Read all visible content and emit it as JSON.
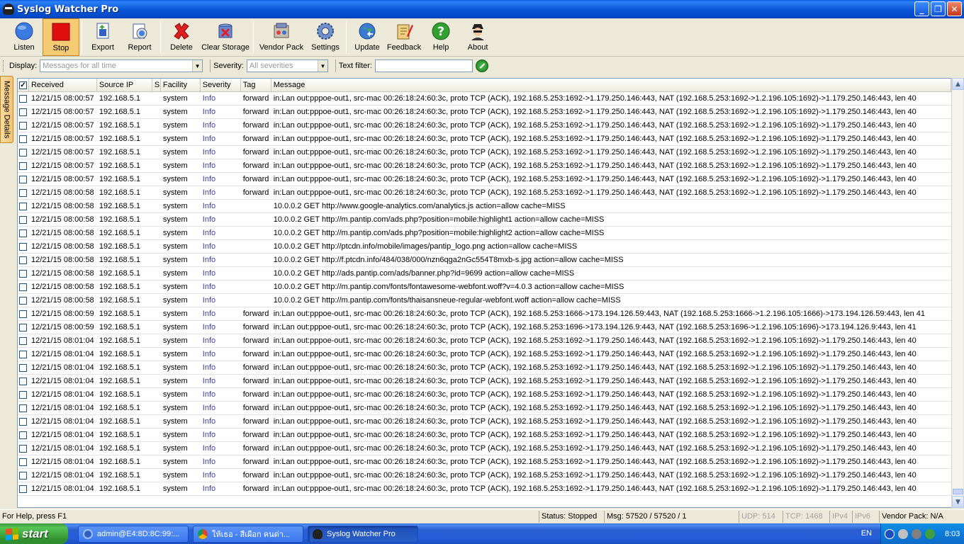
{
  "window": {
    "title": "Syslog Watcher Pro"
  },
  "toolbar": {
    "buttons": [
      {
        "label": "Listen"
      },
      {
        "label": "Stop"
      },
      {
        "label": "Export"
      },
      {
        "label": "Report"
      },
      {
        "label": "Delete"
      },
      {
        "label": "Clear Storage"
      },
      {
        "label": "Vendor Pack"
      },
      {
        "label": "Settings"
      },
      {
        "label": "Update"
      },
      {
        "label": "Feedback"
      },
      {
        "label": "Help"
      },
      {
        "label": "About"
      }
    ]
  },
  "filter": {
    "display_label": "Display:",
    "display_value": "Messages for all time",
    "severity_label": "Severity:",
    "severity_value": "All severities",
    "text_filter_label": "Text filter:",
    "text_filter_value": ""
  },
  "side_tab": {
    "label": "Message Details"
  },
  "grid": {
    "columns": [
      "Received",
      "Source IP",
      "S",
      "Facility",
      "Severity",
      "Tag",
      "Message"
    ],
    "rows": [
      {
        "received": "12/21/15 08:00:57",
        "ip": "192.168.5.1",
        "facility": "system",
        "severity": "Info",
        "tag": "forward",
        "message": "in:Lan out:pppoe-out1, src-mac 00:26:18:24:60:3c, proto TCP (ACK), 192.168.5.253:1692->1.179.250.146:443, NAT (192.168.5.253:1692->1.2.196.105:1692)->1.179.250.146:443, len 40"
      },
      {
        "received": "12/21/15 08:00:57",
        "ip": "192.168.5.1",
        "facility": "system",
        "severity": "Info",
        "tag": "forward",
        "message": "in:Lan out:pppoe-out1, src-mac 00:26:18:24:60:3c, proto TCP (ACK), 192.168.5.253:1692->1.179.250.146:443, NAT (192.168.5.253:1692->1.2.196.105:1692)->1.179.250.146:443, len 40"
      },
      {
        "received": "12/21/15 08:00:57",
        "ip": "192.168.5.1",
        "facility": "system",
        "severity": "Info",
        "tag": "forward",
        "message": "in:Lan out:pppoe-out1, src-mac 00:26:18:24:60:3c, proto TCP (ACK), 192.168.5.253:1692->1.179.250.146:443, NAT (192.168.5.253:1692->1.2.196.105:1692)->1.179.250.146:443, len 40"
      },
      {
        "received": "12/21/15 08:00:57",
        "ip": "192.168.5.1",
        "facility": "system",
        "severity": "Info",
        "tag": "forward",
        "message": "in:Lan out:pppoe-out1, src-mac 00:26:18:24:60:3c, proto TCP (ACK), 192.168.5.253:1692->1.179.250.146:443, NAT (192.168.5.253:1692->1.2.196.105:1692)->1.179.250.146:443, len 40"
      },
      {
        "received": "12/21/15 08:00:57",
        "ip": "192.168.5.1",
        "facility": "system",
        "severity": "Info",
        "tag": "forward",
        "message": "in:Lan out:pppoe-out1, src-mac 00:26:18:24:60:3c, proto TCP (ACK), 192.168.5.253:1692->1.179.250.146:443, NAT (192.168.5.253:1692->1.2.196.105:1692)->1.179.250.146:443, len 40"
      },
      {
        "received": "12/21/15 08:00:57",
        "ip": "192.168.5.1",
        "facility": "system",
        "severity": "Info",
        "tag": "forward",
        "message": "in:Lan out:pppoe-out1, src-mac 00:26:18:24:60:3c, proto TCP (ACK), 192.168.5.253:1692->1.179.250.146:443, NAT (192.168.5.253:1692->1.2.196.105:1692)->1.179.250.146:443, len 40"
      },
      {
        "received": "12/21/15 08:00:57",
        "ip": "192.168.5.1",
        "facility": "system",
        "severity": "Info",
        "tag": "forward",
        "message": "in:Lan out:pppoe-out1, src-mac 00:26:18:24:60:3c, proto TCP (ACK), 192.168.5.253:1692->1.179.250.146:443, NAT (192.168.5.253:1692->1.2.196.105:1692)->1.179.250.146:443, len 40"
      },
      {
        "received": "12/21/15 08:00:58",
        "ip": "192.168.5.1",
        "facility": "system",
        "severity": "Info",
        "tag": "forward",
        "message": "in:Lan out:pppoe-out1, src-mac 00:26:18:24:60:3c, proto TCP (ACK), 192.168.5.253:1692->1.179.250.146:443, NAT (192.168.5.253:1692->1.2.196.105:1692)->1.179.250.146:443, len 40"
      },
      {
        "received": "12/21/15 08:00:58",
        "ip": "192.168.5.1",
        "facility": "system",
        "severity": "Info",
        "tag": "",
        "message": "10.0.0.2 GET http://www.google-analytics.com/analytics.js  action=allow cache=MISS"
      },
      {
        "received": "12/21/15 08:00:58",
        "ip": "192.168.5.1",
        "facility": "system",
        "severity": "Info",
        "tag": "",
        "message": "10.0.0.2 GET http://m.pantip.com/ads.php?position=mobile:highlight1  action=allow cache=MISS"
      },
      {
        "received": "12/21/15 08:00:58",
        "ip": "192.168.5.1",
        "facility": "system",
        "severity": "Info",
        "tag": "",
        "message": "10.0.0.2 GET http://m.pantip.com/ads.php?position=mobile:highlight2  action=allow cache=MISS"
      },
      {
        "received": "12/21/15 08:00:58",
        "ip": "192.168.5.1",
        "facility": "system",
        "severity": "Info",
        "tag": "",
        "message": "10.0.0.2 GET http://ptcdn.info/mobile/images/pantip_logo.png  action=allow cache=MISS"
      },
      {
        "received": "12/21/15 08:00:58",
        "ip": "192.168.5.1",
        "facility": "system",
        "severity": "Info",
        "tag": "",
        "message": "10.0.0.2 GET http://f.ptcdn.info/484/038/000/nzn6qga2nGc554T8mxb-s.jpg  action=allow cache=MISS"
      },
      {
        "received": "12/21/15 08:00:58",
        "ip": "192.168.5.1",
        "facility": "system",
        "severity": "Info",
        "tag": "",
        "message": "10.0.0.2 GET http://ads.pantip.com/ads/banner.php?id=9699  action=allow cache=MISS"
      },
      {
        "received": "12/21/15 08:00:58",
        "ip": "192.168.5.1",
        "facility": "system",
        "severity": "Info",
        "tag": "",
        "message": "10.0.0.2 GET http://m.pantip.com/fonts/fontawesome-webfont.woff?v=4.0.3  action=allow cache=MISS"
      },
      {
        "received": "12/21/15 08:00:58",
        "ip": "192.168.5.1",
        "facility": "system",
        "severity": "Info",
        "tag": "",
        "message": "10.0.0.2 GET http://m.pantip.com/fonts/thaisansneue-regular-webfont.woff  action=allow cache=MISS"
      },
      {
        "received": "12/21/15 08:00:59",
        "ip": "192.168.5.1",
        "facility": "system",
        "severity": "Info",
        "tag": "forward",
        "message": "in:Lan out:pppoe-out1, src-mac 00:26:18:24:60:3c, proto TCP (ACK), 192.168.5.253:1666->173.194.126.59:443, NAT (192.168.5.253:1666->1.2.196.105:1666)->173.194.126.59:443, len 41"
      },
      {
        "received": "12/21/15 08:00:59",
        "ip": "192.168.5.1",
        "facility": "system",
        "severity": "Info",
        "tag": "forward",
        "message": "in:Lan out:pppoe-out1, src-mac 00:26:18:24:60:3c, proto TCP (ACK), 192.168.5.253:1696->173.194.126.9:443, NAT (192.168.5.253:1696->1.2.196.105:1696)->173.194.126.9:443, len 41"
      },
      {
        "received": "12/21/15 08:01:04",
        "ip": "192.168.5.1",
        "facility": "system",
        "severity": "Info",
        "tag": "forward",
        "message": "in:Lan out:pppoe-out1, src-mac 00:26:18:24:60:3c, proto TCP (ACK), 192.168.5.253:1692->1.179.250.146:443, NAT (192.168.5.253:1692->1.2.196.105:1692)->1.179.250.146:443, len 40"
      },
      {
        "received": "12/21/15 08:01:04",
        "ip": "192.168.5.1",
        "facility": "system",
        "severity": "Info",
        "tag": "forward",
        "message": "in:Lan out:pppoe-out1, src-mac 00:26:18:24:60:3c, proto TCP (ACK), 192.168.5.253:1692->1.179.250.146:443, NAT (192.168.5.253:1692->1.2.196.105:1692)->1.179.250.146:443, len 40"
      },
      {
        "received": "12/21/15 08:01:04",
        "ip": "192.168.5.1",
        "facility": "system",
        "severity": "Info",
        "tag": "forward",
        "message": "in:Lan out:pppoe-out1, src-mac 00:26:18:24:60:3c, proto TCP (ACK), 192.168.5.253:1692->1.179.250.146:443, NAT (192.168.5.253:1692->1.2.196.105:1692)->1.179.250.146:443, len 40"
      },
      {
        "received": "12/21/15 08:01:04",
        "ip": "192.168.5.1",
        "facility": "system",
        "severity": "Info",
        "tag": "forward",
        "message": "in:Lan out:pppoe-out1, src-mac 00:26:18:24:60:3c, proto TCP (ACK), 192.168.5.253:1692->1.179.250.146:443, NAT (192.168.5.253:1692->1.2.196.105:1692)->1.179.250.146:443, len 40"
      },
      {
        "received": "12/21/15 08:01:04",
        "ip": "192.168.5.1",
        "facility": "system",
        "severity": "Info",
        "tag": "forward",
        "message": "in:Lan out:pppoe-out1, src-mac 00:26:18:24:60:3c, proto TCP (ACK), 192.168.5.253:1692->1.179.250.146:443, NAT (192.168.5.253:1692->1.2.196.105:1692)->1.179.250.146:443, len 40"
      },
      {
        "received": "12/21/15 08:01:04",
        "ip": "192.168.5.1",
        "facility": "system",
        "severity": "Info",
        "tag": "forward",
        "message": "in:Lan out:pppoe-out1, src-mac 00:26:18:24:60:3c, proto TCP (ACK), 192.168.5.253:1692->1.179.250.146:443, NAT (192.168.5.253:1692->1.2.196.105:1692)->1.179.250.146:443, len 40"
      },
      {
        "received": "12/21/15 08:01:04",
        "ip": "192.168.5.1",
        "facility": "system",
        "severity": "Info",
        "tag": "forward",
        "message": "in:Lan out:pppoe-out1, src-mac 00:26:18:24:60:3c, proto TCP (ACK), 192.168.5.253:1692->1.179.250.146:443, NAT (192.168.5.253:1692->1.2.196.105:1692)->1.179.250.146:443, len 40"
      },
      {
        "received": "12/21/15 08:01:04",
        "ip": "192.168.5.1",
        "facility": "system",
        "severity": "Info",
        "tag": "forward",
        "message": "in:Lan out:pppoe-out1, src-mac 00:26:18:24:60:3c, proto TCP (ACK), 192.168.5.253:1692->1.179.250.146:443, NAT (192.168.5.253:1692->1.2.196.105:1692)->1.179.250.146:443, len 40"
      },
      {
        "received": "12/21/15 08:01:04",
        "ip": "192.168.5.1",
        "facility": "system",
        "severity": "Info",
        "tag": "forward",
        "message": "in:Lan out:pppoe-out1, src-mac 00:26:18:24:60:3c, proto TCP (ACK), 192.168.5.253:1692->1.179.250.146:443, NAT (192.168.5.253:1692->1.2.196.105:1692)->1.179.250.146:443, len 40"
      },
      {
        "received": "12/21/15 08:01:04",
        "ip": "192.168.5.1",
        "facility": "system",
        "severity": "Info",
        "tag": "forward",
        "message": "in:Lan out:pppoe-out1, src-mac 00:26:18:24:60:3c, proto TCP (ACK), 192.168.5.253:1692->1.179.250.146:443, NAT (192.168.5.253:1692->1.2.196.105:1692)->1.179.250.146:443, len 40"
      },
      {
        "received": "12/21/15 08:01:04",
        "ip": "192.168.5.1",
        "facility": "system",
        "severity": "Info",
        "tag": "forward",
        "message": "in:Lan out:pppoe-out1, src-mac 00:26:18:24:60:3c, proto TCP (ACK), 192.168.5.253:1692->1.179.250.146:443, NAT (192.168.5.253:1692->1.2.196.105:1692)->1.179.250.146:443, len 40"
      },
      {
        "received": "12/21/15 08:01:04",
        "ip": "192.168.5.1",
        "facility": "system",
        "severity": "Info",
        "tag": "forward",
        "message": "in:Lan out:pppoe-out1, src-mac 00:26:18:24:60:3c, proto TCP (ACK), 192.168.5.253:1692->1.179.250.146:443, NAT (192.168.5.253:1692->1.2.196.105:1692)->1.179.250.146:443, len 40"
      }
    ]
  },
  "statusbar": {
    "help": "For Help, press F1",
    "status": "Status: Stopped",
    "msg": "Msg: 57520 / 57520 / 1",
    "udp": "UDP: 514",
    "tcp": "TCP: 1468",
    "ipv4": "IPv4",
    "ipv6": "IPv6",
    "vendor": "Vendor Pack: N/A"
  },
  "taskbar": {
    "start": "start",
    "tasks": [
      {
        "label": "admin@E4:8D:8C:99:..."
      },
      {
        "label": "ให้เธอ - สีเผือก คนด่า..."
      },
      {
        "label": "Syslog Watcher Pro"
      }
    ],
    "lang": "EN",
    "clock": "8:03"
  },
  "colors": {
    "severity_info": "#4040a0",
    "active_button": "#f4ca72",
    "titlebar": "#0b58d8"
  }
}
